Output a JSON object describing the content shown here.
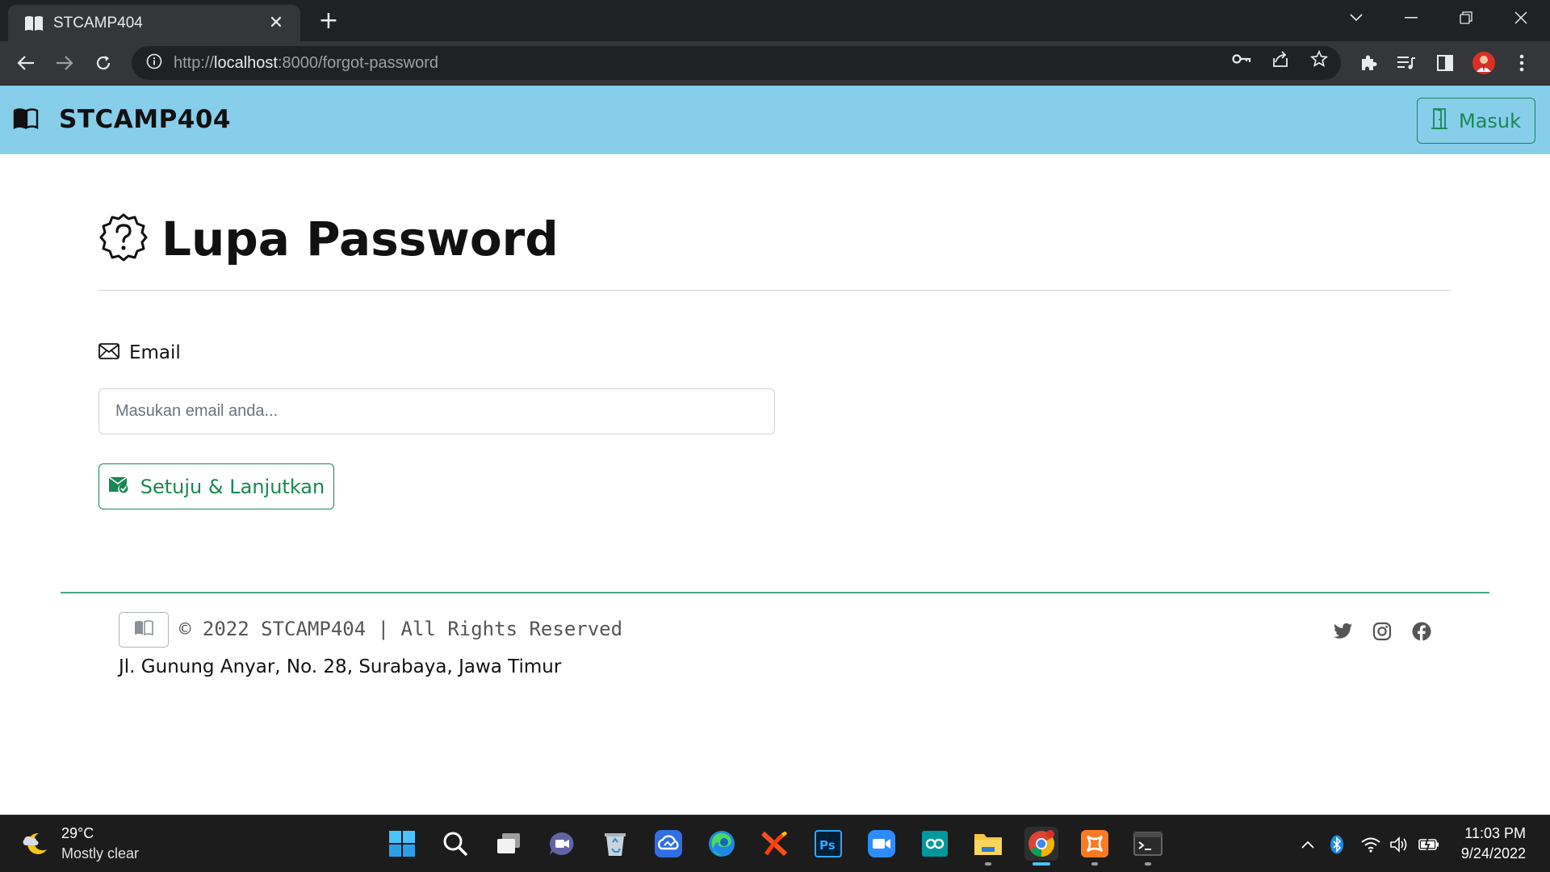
{
  "browser": {
    "tab_title": "STCAMP404",
    "tab_icon": "open-book-icon",
    "new_tab_label": "+",
    "url_scheme": "http://",
    "url_host": "localhost",
    "url_rest": ":8000/forgot-password"
  },
  "navbar": {
    "brand": "STCAMP404",
    "login_label": "Masuk",
    "bg_color": "#87ceeb",
    "accent_color": "#198754"
  },
  "main": {
    "title": "Lupa Password",
    "email_label": "Email",
    "email_placeholder": "Masukan email anda...",
    "email_value": "",
    "submit_label": "Setuju & Lanjutkan"
  },
  "footer": {
    "copyright": "© 2022 STCAMP404 | All Rights Reserved",
    "address": "Jl. Gunung Anyar, No. 28, Surabaya, Jawa Timur",
    "social": [
      "twitter-icon",
      "instagram-icon",
      "facebook-icon"
    ]
  },
  "taskbar": {
    "weather_temp": "29°C",
    "weather_desc": "Mostly clear",
    "time": "11:03 PM",
    "date": "9/24/2022",
    "apps": [
      "windows-start",
      "search",
      "task-view",
      "teams-chat",
      "recycle-bin",
      "cloud-app",
      "edge",
      "xampp-x",
      "photoshop",
      "zoom",
      "arduino",
      "file-explorer",
      "chrome",
      "xampp",
      "terminal"
    ]
  }
}
